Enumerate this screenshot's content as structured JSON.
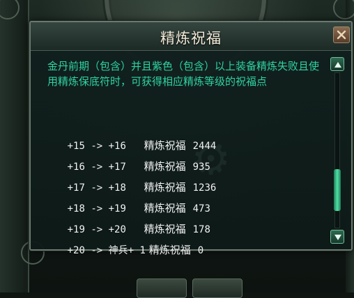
{
  "panel": {
    "title": "精炼祝福",
    "description": "金丹前期（包含）并且紫色（包含）以上装备精炼失败且使用精炼保底符时，可获得相应精炼等级的祝福点",
    "rows": [
      {
        "range": "+15 -> +16",
        "label": "精炼祝福",
        "value": "2444"
      },
      {
        "range": "+16 -> +17",
        "label": "精炼祝福",
        "value": "935"
      },
      {
        "range": "+17 -> +18",
        "label": "精炼祝福",
        "value": "1236"
      },
      {
        "range": "+18 -> +19",
        "label": "精炼祝福",
        "value": "473"
      },
      {
        "range": "+19 -> +20",
        "label": "精炼祝福",
        "value": "178"
      },
      {
        "range": "+20 -> 神兵+ 1",
        "label": "精炼祝福",
        "value": "0"
      }
    ]
  },
  "scrollbar": {
    "position_fraction": 0.85
  },
  "colors": {
    "description_text": "#2fd3a2",
    "row_text": "#f2f2f2",
    "title_text": "#f3ecd8",
    "scroll_thumb": "#4fe1a4"
  },
  "icons": {
    "close": "close-icon",
    "scroll_up": "triangle-up-icon",
    "scroll_down": "triangle-down-icon"
  }
}
